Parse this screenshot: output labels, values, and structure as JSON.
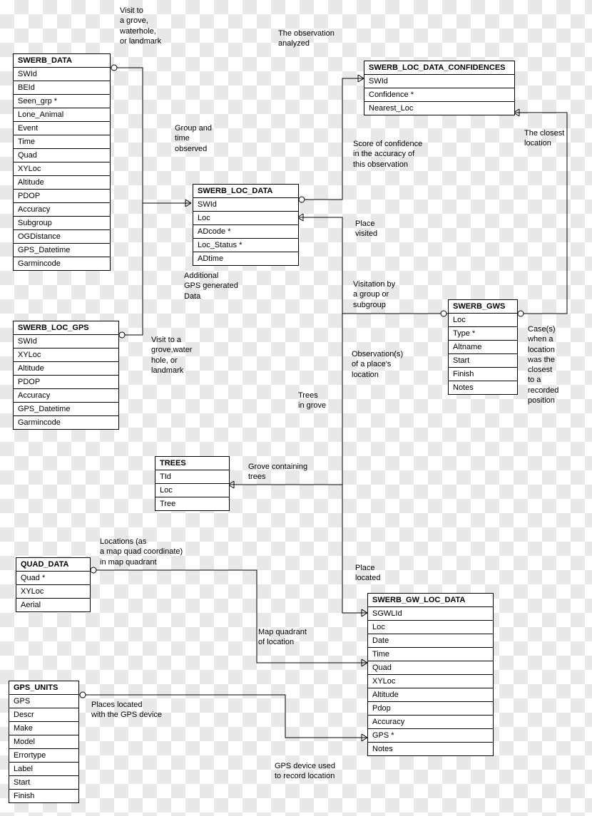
{
  "entities": {
    "swerb_data": {
      "title": "SWERB_DATA",
      "fields": [
        "SWId",
        "BEId",
        "Seen_grp *",
        "Lone_Animal",
        "Event",
        "Time",
        "Quad",
        "XYLoc",
        "Altitude",
        "PDOP",
        "Accuracy",
        "Subgroup",
        "OGDistance",
        "GPS_Datetime",
        "Garmincode"
      ]
    },
    "swerb_loc_data_confidences": {
      "title": "SWERB_LOC_DATA_CONFIDENCES",
      "fields": [
        "SWId",
        "Confidence *",
        "Nearest_Loc"
      ]
    },
    "swerb_loc_data": {
      "title": "SWERB_LOC_DATA",
      "fields": [
        "SWId",
        "Loc",
        "ADcode *",
        "Loc_Status *",
        "ADtime"
      ]
    },
    "swerb_loc_gps": {
      "title": "SWERB_LOC_GPS",
      "fields": [
        "SWId",
        "XYLoc",
        "Altitude",
        "PDOP",
        "Accuracy",
        "GPS_Datetime",
        "Garmincode"
      ]
    },
    "swerb_gws": {
      "title": "SWERB_GWS",
      "fields": [
        "Loc",
        "Type *",
        "Altname",
        "Start",
        "Finish",
        "Notes"
      ]
    },
    "trees": {
      "title": "TREES",
      "fields": [
        "TId",
        "Loc",
        "Tree"
      ]
    },
    "quad_data": {
      "title": "QUAD_DATA",
      "fields": [
        "Quad *",
        "XYLoc",
        "Aerial"
      ]
    },
    "swerb_gw_loc_data": {
      "title": "SWERB_GW_LOC_DATA",
      "fields": [
        "SGWLId",
        "Loc",
        "Date",
        "Time",
        "Quad",
        "XYLoc",
        "Altitude",
        "Pdop",
        "Accuracy",
        "GPS *",
        "Notes"
      ]
    },
    "gps_units": {
      "title": "GPS_UNITS",
      "fields": [
        "GPS",
        "Descr",
        "Make",
        "Model",
        "Errortype",
        "Label",
        "Start",
        "Finish"
      ]
    }
  },
  "labels": {
    "visit_grove": "Visit to\na grove,\nwaterhole,\nor landmark",
    "observation_analyzed": "The observation\nanalyzed",
    "group_time": "Group and\ntime\nobserved",
    "score_conf": "Score of confidence\nin the accuracy of\nthis observation",
    "closest_loc": "The closest\nlocation",
    "additional_gps": "Additional\nGPS generated\nData",
    "place_visited": "Place\nvisited",
    "visit_grove2": "Visit to a\ngrove,water\nhole, or\nlandmark",
    "visitation": "Visitation by\na group or\nsubgroup",
    "obs_place": "Observation(s)\nof a place's\nlocation",
    "trees_in_grove": "Trees\nin grove",
    "cases_when": "Case(s)\nwhen a\nlocation\nwas the\nclosest\nto a\nrecorded\nposition",
    "grove_containing": "Grove containing\ntrees",
    "locations_quad": "Locations (as\na map quad coordinate)\nin map quadrant",
    "place_located": "Place\nlocated",
    "map_quadrant": "Map quadrant\nof location",
    "places_located": "Places located\nwith the GPS device",
    "gps_device": "GPS device used\nto record location"
  }
}
